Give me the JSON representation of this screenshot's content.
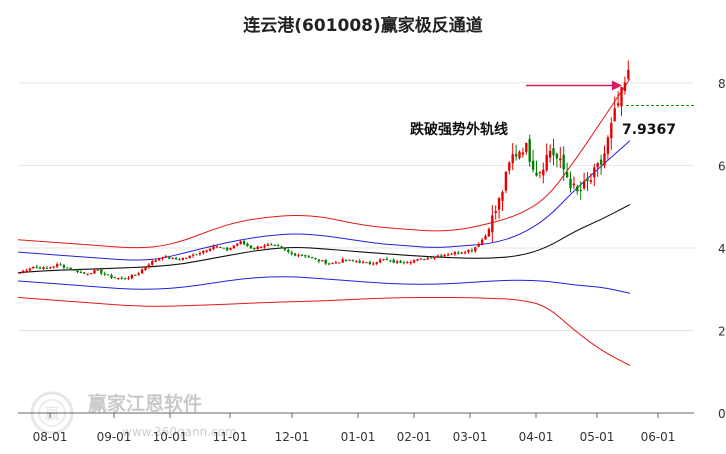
{
  "chart_data": {
    "type": "candlestick",
    "title": "连云港(601008)赢家极反通道",
    "x_tick_labels": [
      "08-01",
      "09-01",
      "10-01",
      "11-01",
      "12-01",
      "01-01",
      "02-01",
      "03-01",
      "04-01",
      "05-01",
      "06-01"
    ],
    "y_tick_labels": [
      "0",
      "2",
      "4",
      "6",
      "8"
    ],
    "ylim": [
      0,
      8.7
    ],
    "grid": "horizontal",
    "annotation": {
      "label": "跌破强势外轨线",
      "value_text": "7.9367",
      "value": 7.9367
    },
    "colors": {
      "up": "#e60000",
      "down": "#008000",
      "outer_bands": "#e41a1a",
      "mid_bands": "#2222dd",
      "center_line": "#111111",
      "arrow": "#d81b60",
      "level_line": "#009900"
    },
    "series": {
      "upper_outer": [
        4.2,
        4.15,
        4.1,
        4.05,
        4,
        4.02,
        4.18,
        4.45,
        4.65,
        4.75,
        4.8,
        4.75,
        4.6,
        4.5,
        4.45,
        4.4,
        4.45,
        4.6,
        4.8,
        5.2,
        6.1,
        7.1,
        8.1
      ],
      "upper_mid": [
        3.9,
        3.85,
        3.8,
        3.75,
        3.7,
        3.72,
        3.88,
        4.05,
        4.2,
        4.3,
        4.35,
        4.3,
        4.2,
        4.1,
        4.05,
        4,
        4.05,
        4.1,
        4.3,
        4.7,
        5.4,
        6,
        6.6
      ],
      "center": [
        3.4,
        3.45,
        3.47,
        3.5,
        3.52,
        3.55,
        3.62,
        3.75,
        3.87,
        3.98,
        4.02,
        3.98,
        3.92,
        3.87,
        3.82,
        3.78,
        3.75,
        3.75,
        3.8,
        4.0,
        4.4,
        4.7,
        5.05
      ],
      "lower_mid": [
        3.2,
        3.15,
        3.1,
        3.05,
        3.0,
        3.0,
        3.05,
        3.15,
        3.25,
        3.3,
        3.3,
        3.25,
        3.2,
        3.15,
        3.12,
        3.12,
        3.15,
        3.2,
        3.22,
        3.2,
        3.1,
        3.05,
        2.9
      ],
      "lower_outer": [
        2.8,
        2.75,
        2.7,
        2.65,
        2.6,
        2.58,
        2.6,
        2.62,
        2.65,
        2.68,
        2.7,
        2.72,
        2.75,
        2.78,
        2.8,
        2.8,
        2.8,
        2.78,
        2.75,
        2.6,
        2.0,
        1.5,
        1.15
      ],
      "close": [
        3.4,
        3.55,
        3.5,
        3.6,
        3.48,
        3.38,
        3.45,
        3.3,
        3.25,
        3.35,
        3.62,
        3.8,
        3.72,
        3.78,
        3.9,
        4.05,
        3.95,
        4.15,
        3.98,
        4.08,
        4.02,
        3.85,
        3.82,
        3.7,
        3.62,
        3.7,
        3.68,
        3.62,
        3.72,
        3.65,
        3.68,
        3.72,
        3.8,
        3.85,
        3.9,
        3.96,
        4.3,
        5.1,
        6.2,
        6.5,
        5.8,
        6.4,
        5.9,
        5.3,
        5.6,
        6.1,
        7.3,
        8.2
      ]
    }
  },
  "watermark": {
    "brand": "赢家江恩软件",
    "url": "www.360gann.com",
    "seal": "赢"
  }
}
